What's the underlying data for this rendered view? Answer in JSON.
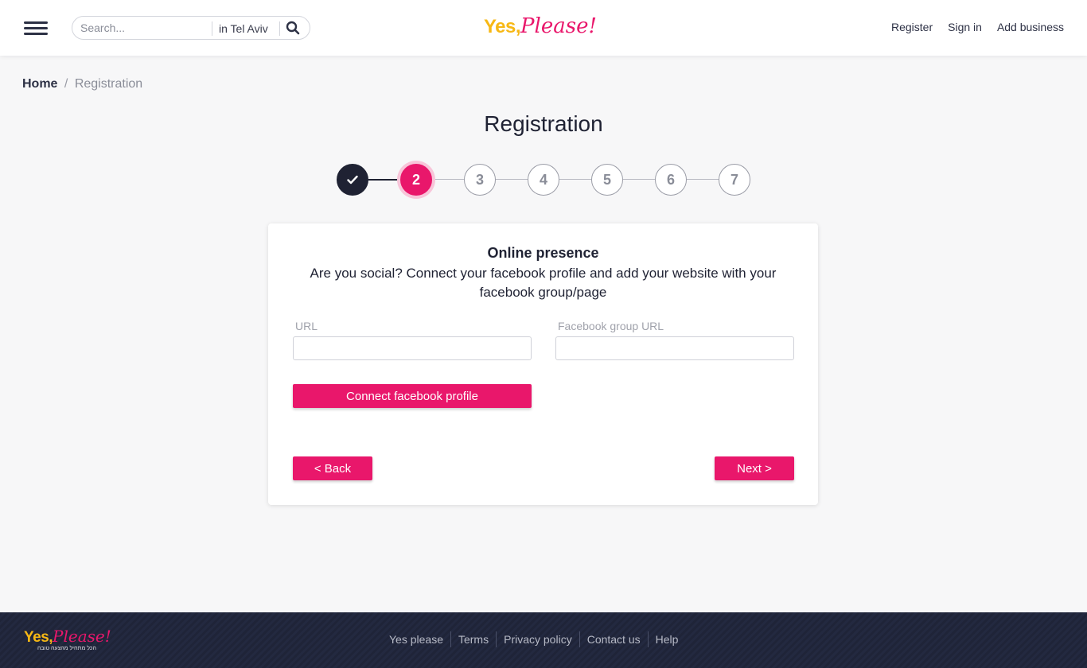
{
  "header": {
    "search_placeholder": "Search...",
    "search_location": "in Tel Aviv",
    "logo_yes": "Yes,",
    "logo_please": "Please!",
    "nav": {
      "register": "Register",
      "sign_in": "Sign in",
      "add_business": "Add business"
    }
  },
  "breadcrumb": {
    "home": "Home",
    "separator": "/",
    "current": "Registration"
  },
  "page_title": "Registration",
  "stepper": {
    "steps": [
      "✔",
      "2",
      "3",
      "4",
      "5",
      "6",
      "7"
    ],
    "completed": 1,
    "active_step": 2
  },
  "card": {
    "title": "Online presence",
    "description": "Are you social? Connect your facebook profile and add your website with your facebook group/page",
    "url_label": "URL",
    "url_value": "",
    "facebook_label": "Facebook group URL",
    "facebook_value": "",
    "connect_button": "Connect facebook profile",
    "back_button": "< Back",
    "next_button": "Next >"
  },
  "footer": {
    "logo_yes": "Yes,",
    "logo_please": "Please!",
    "tagline": "הכל מתחיל מהצעה טובה",
    "links": [
      "Yes please",
      "Terms",
      "Privacy policy",
      "Contact us",
      "Help"
    ]
  },
  "colors": {
    "brand_pink": "#e9176b",
    "brand_yellow": "#f7b814",
    "dark_navy": "#1f2233"
  }
}
